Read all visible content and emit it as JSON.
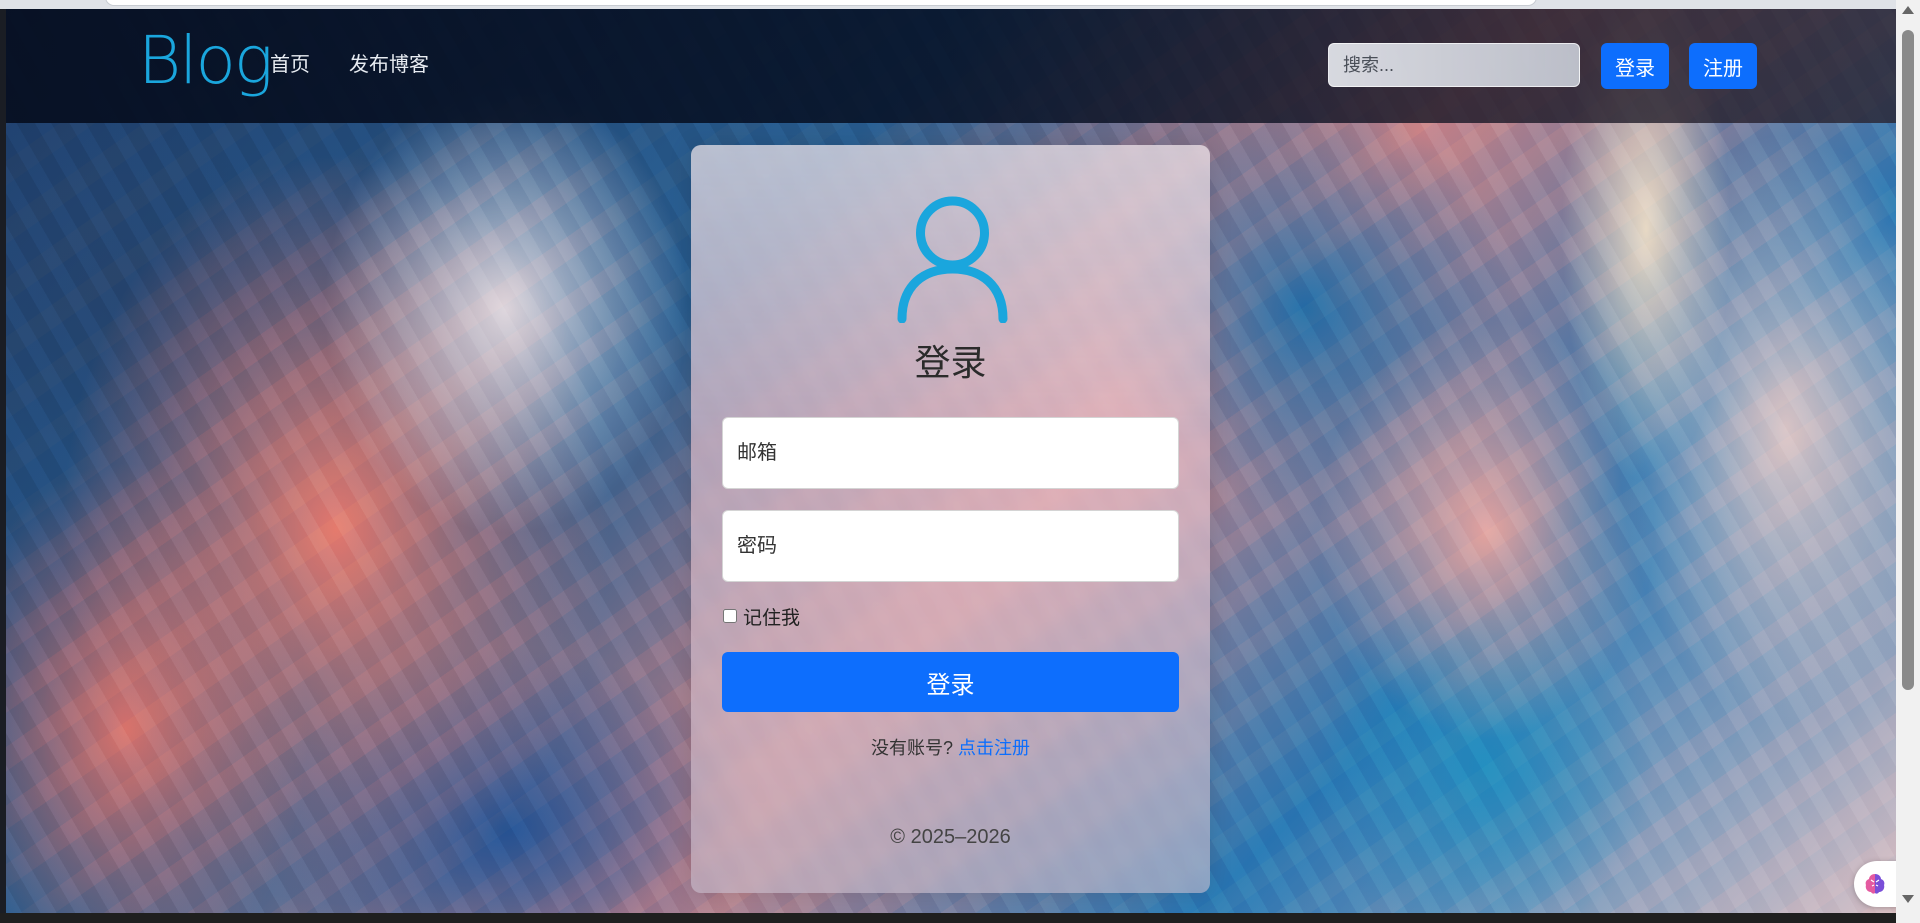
{
  "navbar": {
    "brand": "Blog",
    "links": [
      "首页",
      "发布博客"
    ],
    "search_placeholder": "搜索...",
    "login_label": "登录",
    "register_label": "注册"
  },
  "login_card": {
    "title": "登录",
    "email_placeholder": "邮箱",
    "password_placeholder": "密码",
    "remember_label": "记住我",
    "submit_label": "登录",
    "no_account_text": "没有账号?",
    "signup_link": "点击注册",
    "copyright": "© 2025–2026"
  },
  "colors": {
    "accent": "#0d6efd",
    "brand": "#1aa6dd",
    "user_icon": "#1aa6dd"
  },
  "icons": {
    "user": "user-icon",
    "assistant": "brain-icon"
  }
}
